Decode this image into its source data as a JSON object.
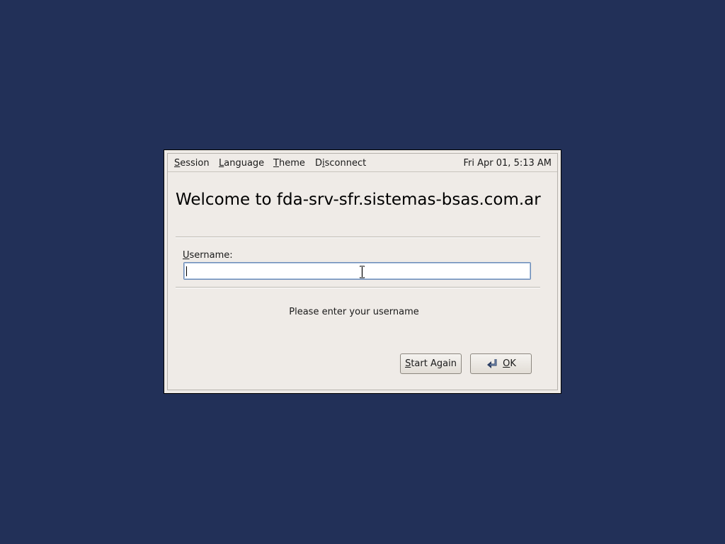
{
  "menubar": {
    "items": [
      {
        "mnemonic": "S",
        "rest": "ession"
      },
      {
        "mnemonic": "L",
        "rest": "anguage"
      },
      {
        "mnemonic": "T",
        "rest": "heme"
      },
      {
        "pre": "D",
        "mnemonic": "i",
        "rest": "sconnect"
      }
    ],
    "clock": "Fri Apr 01,  5:13 AM"
  },
  "welcome": "Welcome to fda-srv-sfr.sistemas-bsas.com.ar",
  "username": {
    "label_mnemonic": "U",
    "label_rest": "sername:",
    "value": ""
  },
  "prompt": "Please enter your username",
  "buttons": {
    "start_again": {
      "mnemonic": "S",
      "rest": "tart Again"
    },
    "ok": {
      "mnemonic": "O",
      "rest": "K",
      "icon": "enter-arrow-icon"
    }
  },
  "colors": {
    "desktop_background": "#223058",
    "dialog_background": "#efebe7"
  }
}
